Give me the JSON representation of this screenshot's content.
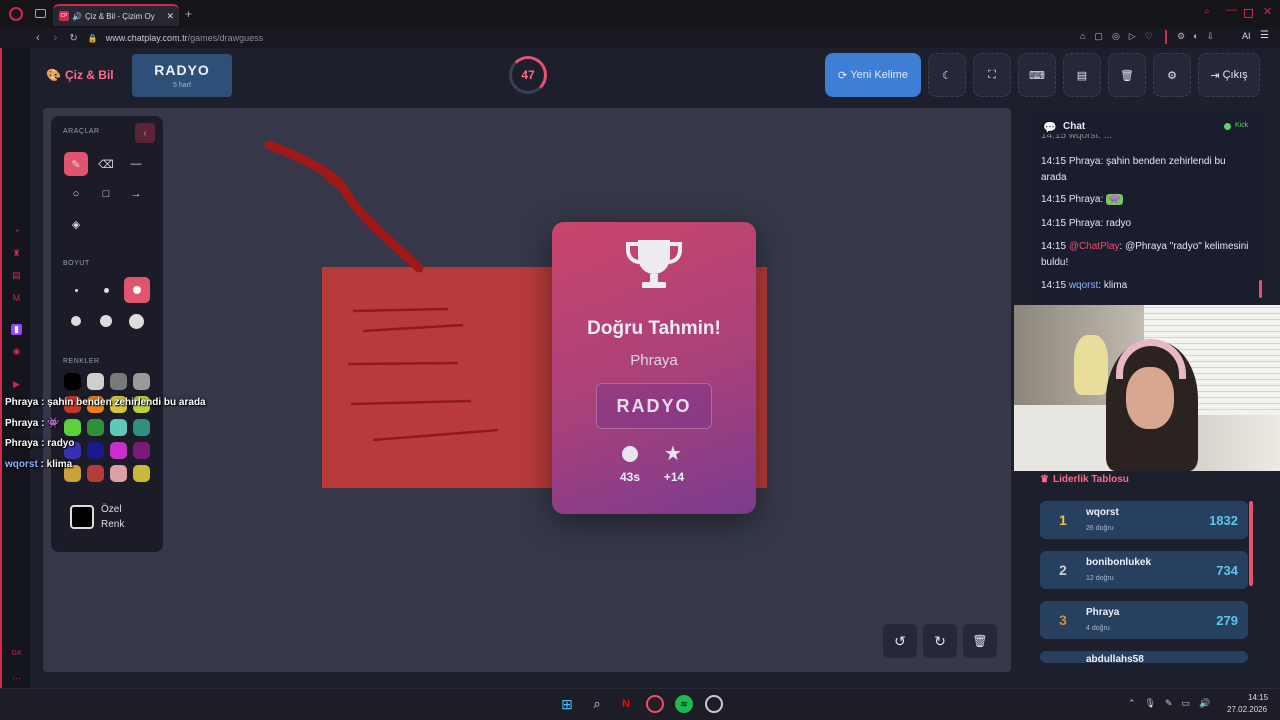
{
  "browser": {
    "tab_title": "Çiz & Bil - Çizim Oy",
    "tab_favicon": "CP",
    "url_domain": "www.chatplay.com.tr",
    "url_path": "/games/drawguess",
    "ai_label": "AI"
  },
  "header": {
    "logo": "Çiz & Bil",
    "word": "RADYO",
    "word_hint": "5 harf",
    "timer": "47",
    "new_word_label": "Yeni Kelime",
    "exit_label": "Çıkış"
  },
  "tools": {
    "section_tools": "ARAÇLAR",
    "section_size": "BOYUT",
    "section_colors": "RENKLER",
    "custom_color_label": "Özel Renk",
    "swatches": [
      "#000000",
      "#cfcfcf",
      "#7a7a7a",
      "#9a9a9a",
      "#c0392b",
      "#e67e22",
      "#d4c63b",
      "#b6d33c",
      "#5bd13b",
      "#2f8f3a",
      "#5fc9b8",
      "#2f8f80",
      "#3a2fb0",
      "#1a1a8a",
      "#c82fc8",
      "#7a1a7a",
      "#c9a23a",
      "#b83a3a",
      "#d9a0a8",
      "#c9b93a"
    ]
  },
  "result_card": {
    "title": "Doğru Tahmin!",
    "player": "Phraya",
    "word": "RADYO",
    "time": "43s",
    "points": "+14"
  },
  "overlay_chat": [
    {
      "user": "Phraya",
      "text": "şahin benden zehirlendi bu arada"
    },
    {
      "user": "Phraya",
      "text": "👾"
    },
    {
      "user": "Phraya",
      "text": "radyo"
    },
    {
      "user": "wqorst",
      "text": "klima"
    }
  ],
  "chat": {
    "title": "Chat",
    "status": "Kick",
    "partial_top": "14:15 wqorst: ...",
    "messages": [
      {
        "time": "14:15",
        "user": "Phraya",
        "text": "şahin benden zehirlendi bu arada"
      },
      {
        "time": "14:15",
        "user": "Phraya",
        "text": "👾"
      },
      {
        "time": "14:15",
        "user": "Phraya",
        "text": "radyo"
      },
      {
        "time": "14:15",
        "user": "@ChatPlay",
        "text": "@Phraya \"radyo\" kelimesini buldu!"
      },
      {
        "time": "14:15",
        "user": "wqorst",
        "text": "klima"
      }
    ]
  },
  "leaderboard": {
    "title": "Liderlik Tablosu",
    "rows": [
      {
        "rank": "1",
        "name": "wqorst",
        "sub": "26 doğru",
        "score": "1832"
      },
      {
        "rank": "2",
        "name": "bonibonlukek",
        "sub": "12 doğru",
        "score": "734"
      },
      {
        "rank": "3",
        "name": "Phraya",
        "sub": "4 doğru",
        "score": "279"
      },
      {
        "rank": "",
        "name": "abdullahs58",
        "sub": "",
        "score": ""
      }
    ]
  },
  "taskbar": {
    "time": "14:15",
    "date": "27.02.2026"
  },
  "colors": {
    "accent": "#d0294a",
    "primary_button": "#3d7fd6",
    "score_text": "#5cc6e8"
  }
}
